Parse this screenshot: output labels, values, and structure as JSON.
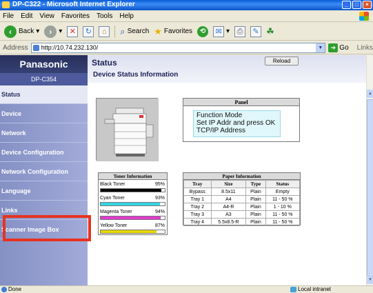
{
  "window": {
    "title": "DP-C322 - Microsoft Internet Explorer",
    "controls": [
      "_",
      "□",
      "×"
    ]
  },
  "menu": [
    "File",
    "Edit",
    "View",
    "Favorites",
    "Tools",
    "Help"
  ],
  "toolbar": {
    "back": "Back",
    "search": "Search",
    "favorites": "Favorites"
  },
  "address": {
    "label": "Address",
    "url": "http://10.74.232.130/",
    "go": "Go",
    "links": "Links"
  },
  "brand": {
    "name": "Panasonic",
    "model": "DP-C354"
  },
  "nav": {
    "items": [
      "Status",
      "Device",
      "Network",
      "Device Configuration",
      "Network Configuration",
      "Language",
      "Links",
      "Scanner Image Box"
    ],
    "active": "Status",
    "highlighted": "Scanner Image Box"
  },
  "page": {
    "title": "Status",
    "reload": "Reload",
    "subtitle": "Device Status Information"
  },
  "panel": {
    "title": "Panel",
    "lines": [
      "Function Mode",
      "Set IP Addr and press OK",
      "TCP/IP Address"
    ]
  },
  "toner": {
    "title": "Toner Information",
    "items": [
      {
        "name": "Black Toner",
        "percent": "95%",
        "level": 95,
        "color": "#000000"
      },
      {
        "name": "Cyan Toner",
        "percent": "93%",
        "level": 93,
        "color": "#34d6e2"
      },
      {
        "name": "Magenta Toner",
        "percent": "94%",
        "level": 94,
        "color": "#e03ccf"
      },
      {
        "name": "Yellow Toner",
        "percent": "87%",
        "level": 87,
        "color": "#e8d800"
      }
    ]
  },
  "paper": {
    "title": "Paper Information",
    "headers": [
      "Tray",
      "Size",
      "Type",
      "Status"
    ],
    "rows": [
      [
        "Bypass",
        "8.5x11",
        "Plain",
        "Empty"
      ],
      [
        "Tray 1",
        "A4",
        "Plain",
        "11 - 50 %"
      ],
      [
        "Tray 2",
        "A4-R",
        "Plain",
        "1 - 10 %"
      ],
      [
        "Tray 3",
        "A3",
        "Plain",
        "11 - 50 %"
      ],
      [
        "Tray 4",
        "5.5x8.5-R",
        "Plain",
        "11 - 50 %"
      ]
    ]
  },
  "statusbar": {
    "left": "Done",
    "zone": "Local intranet"
  }
}
